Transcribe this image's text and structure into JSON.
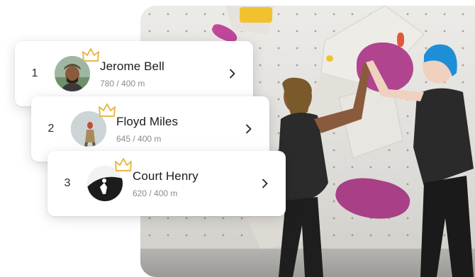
{
  "leaderboard": {
    "entries": [
      {
        "rank": "1",
        "name": "Jerome Bell",
        "distance": "780 / 400 m"
      },
      {
        "rank": "2",
        "name": "Floyd Miles",
        "distance": "645 / 400 m"
      },
      {
        "rank": "3",
        "name": "Court Henry",
        "distance": "620 / 400 m"
      }
    ]
  },
  "icons": {
    "crown": "crown-icon",
    "chevron": "chevron-right-icon"
  },
  "colors": {
    "crown": "#e9b84a",
    "card_background": "#ffffff",
    "hold_magenta": "#b0448f",
    "hold_yellow": "#f2c22e",
    "hair_blue": "#1e8fd6"
  }
}
